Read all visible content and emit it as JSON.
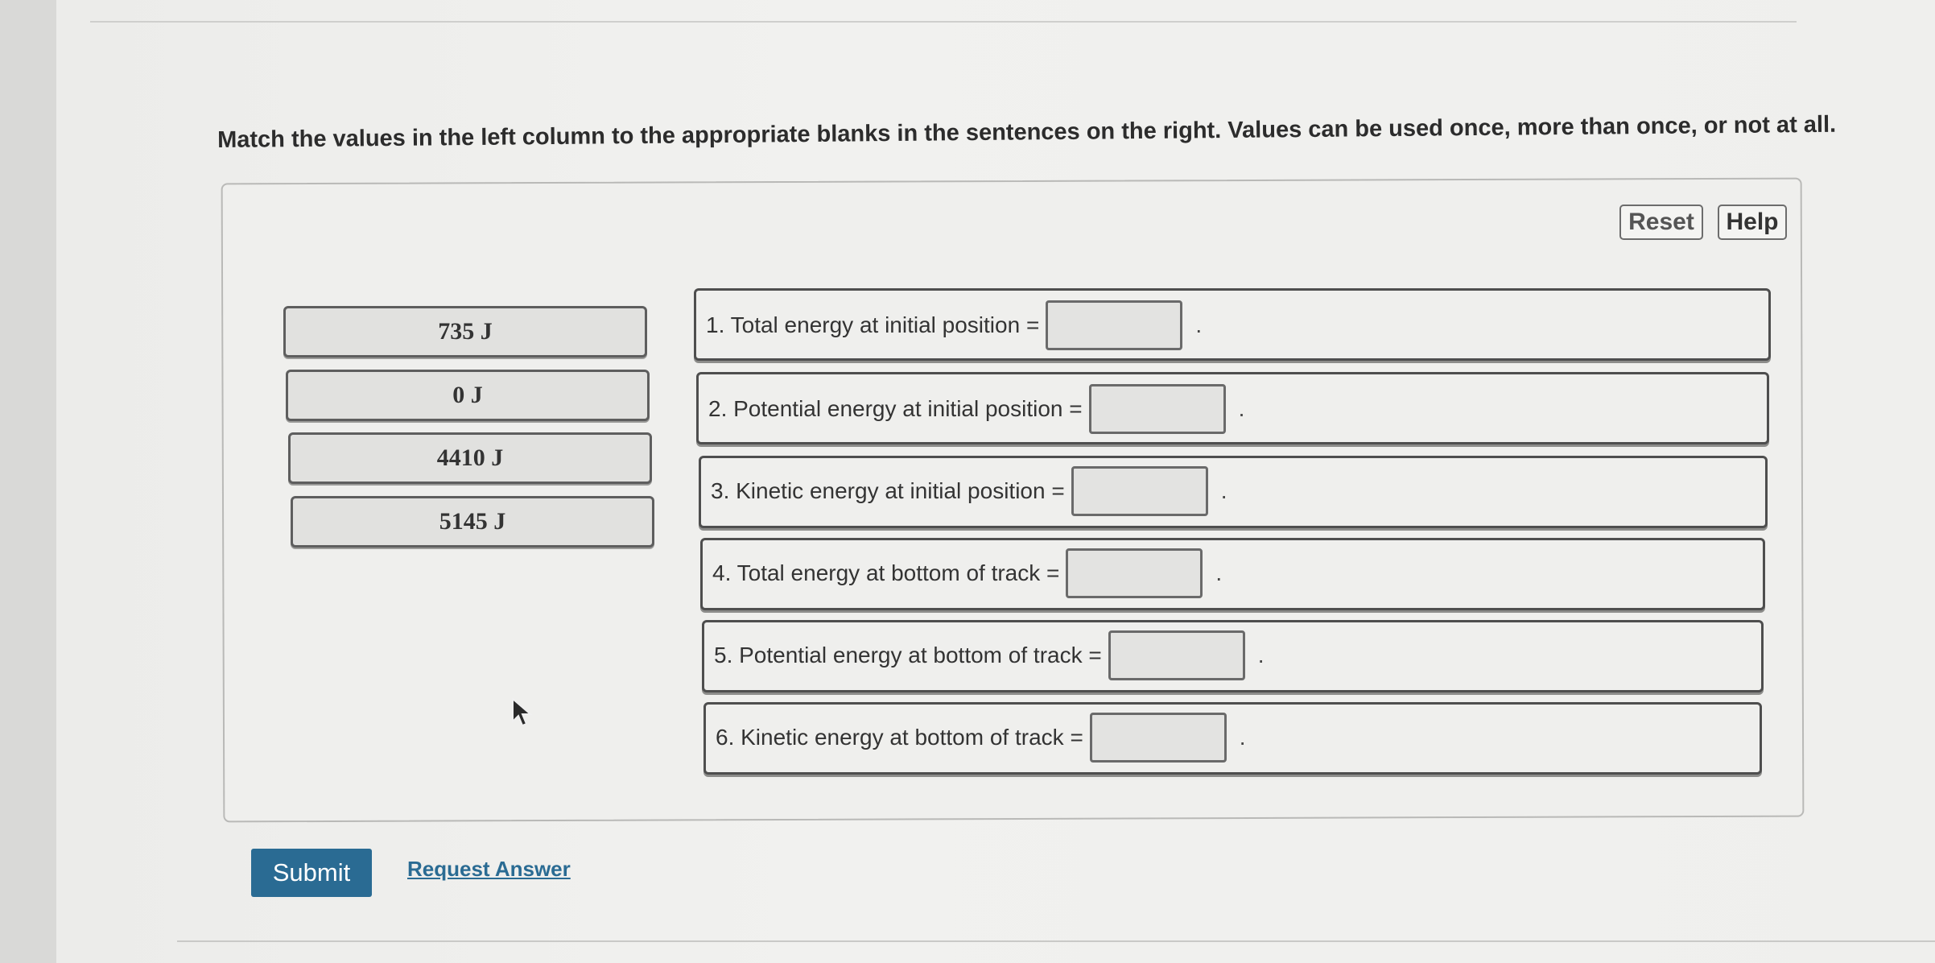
{
  "instructions": "Match the values in the left column to the appropriate blanks in the sentences on the right. Values can be used once, more than once, or not at all.",
  "toolbar": {
    "reset_label": "Reset",
    "help_label": "Help"
  },
  "values": [
    {
      "label": "735 J"
    },
    {
      "label": "0 J"
    },
    {
      "label": "4410 J"
    },
    {
      "label": "5145 J"
    }
  ],
  "sentences": [
    {
      "text": "1. Total energy at initial position =",
      "blank_value": "",
      "period": "."
    },
    {
      "text": "2. Potential energy at initial position =",
      "blank_value": "",
      "period": "."
    },
    {
      "text": "3. Kinetic energy at initial position =",
      "blank_value": "",
      "period": "."
    },
    {
      "text": "4. Total energy at bottom of track =",
      "blank_value": "",
      "period": "."
    },
    {
      "text": "5. Potential energy at bottom of track =",
      "blank_value": "",
      "period": "."
    },
    {
      "text": "6. Kinetic energy at bottom of track =",
      "blank_value": "",
      "period": "."
    }
  ],
  "actions": {
    "submit_label": "Submit",
    "request_answer_label": "Request Answer"
  },
  "colors": {
    "accent": "#2a6b93",
    "page_background": "#efefed"
  },
  "icons": {
    "cursor": "mouse-pointer-icon"
  }
}
